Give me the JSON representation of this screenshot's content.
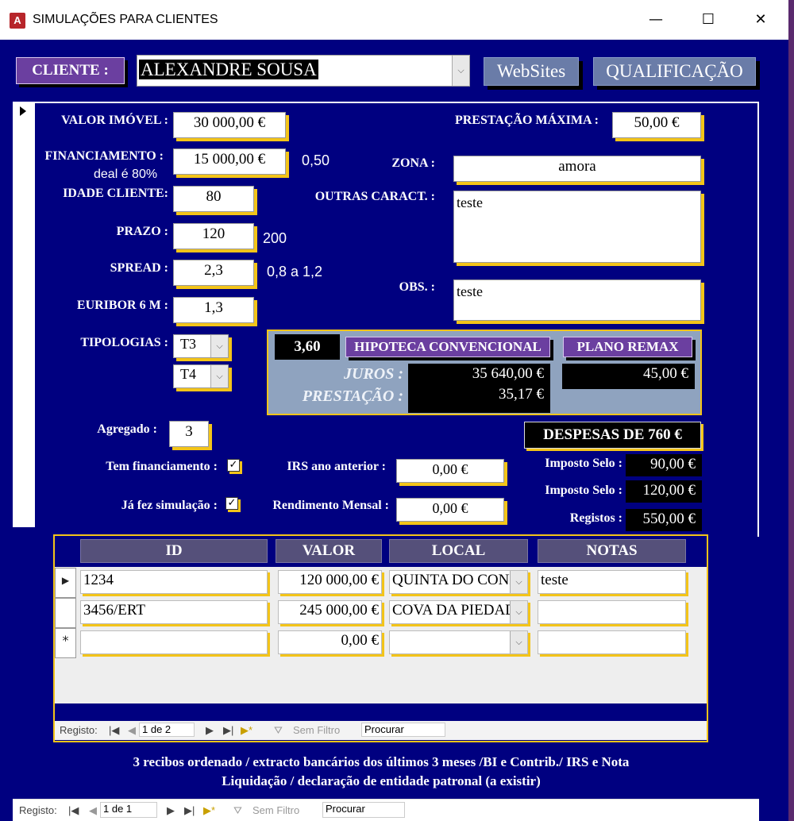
{
  "window": {
    "title": "SIMULAÇÕES PARA CLIENTES",
    "app_icon": "A",
    "minimize": "—",
    "maximize": "☐",
    "close": "✕"
  },
  "header": {
    "cliente_label": "CLIENTE :",
    "cliente_value": "ALEXANDRE SOUSA",
    "websites_button": "WebSites",
    "qualificacao_button": "QUALIFICAÇÃO"
  },
  "fields": {
    "valor_imovel_label": "VALOR IMÓVEL :",
    "valor_imovel": "30 000,00 €",
    "financiamento_label": "FINANCIAMENTO :",
    "financiamento": "15 000,00 €",
    "financiamento_ratio": "0,50",
    "deal_note": "deal é 80%",
    "idade_label": "IDADE CLIENTE:",
    "idade": "80",
    "prazo_label": "PRAZO :",
    "prazo": "120",
    "prazo_note": "200",
    "spread_label": "SPREAD :",
    "spread": "2,3",
    "spread_note": "0,8 a 1,2",
    "euribor_label": "EURIBOR 6 M :",
    "euribor": "1,3",
    "tipologias_label": "TIPOLOGIAS :",
    "tipologia_1": "T3",
    "tipologia_2": "T4",
    "prestacao_max_label": "PRESTAÇÃO MÁXIMA :",
    "prestacao_max": "50,00 €",
    "zona_label": "ZONA :",
    "zona": "amora",
    "outras_label": "OUTRAS CARACT. :",
    "outras": "teste",
    "obs_label": "OBS. :",
    "obs": "teste",
    "agregado_label": "Agregado :",
    "agregado": "3",
    "tem_financiamento_label": "Tem financiamento :",
    "ja_fez_simulacao_label": "Já fez simulação :",
    "irs_label": "IRS ano anterior :",
    "irs": "0,00 €",
    "rendimento_label": "Rendimento Mensal :",
    "rendimento": "0,00 €",
    "check_mark": "✓"
  },
  "simulation": {
    "taxa": "3,60",
    "hipoteca_button": "HIPOTECA CONVENCIONAL",
    "plano_button": "PLANO REMAX",
    "juros_label": "JUROS :",
    "prestacao_label": "PRESTAÇÃO :",
    "juros": "35 640,00 €",
    "prestacao": "35,17 €",
    "remax_value": "45,00 €"
  },
  "despesas": {
    "title": "DESPESAS DE 760 €",
    "imposto_selo_label_1": "Imposto Selo :",
    "imposto_selo_1": "90,00 €",
    "imposto_selo_label_2": "Imposto Selo :",
    "imposto_selo_2": "120,00 €",
    "registos_label": "Registos :",
    "registos": "550,00 €"
  },
  "subform": {
    "headers": [
      "ID",
      "VALOR",
      "LOCAL",
      "NOTAS"
    ],
    "rows": [
      {
        "selector": "▶",
        "id": "1234",
        "valor": "120 000,00 €",
        "local": "QUINTA DO CONDE",
        "notas": "teste"
      },
      {
        "selector": "",
        "id": "3456/ERT",
        "valor": "245 000,00 €",
        "local": "COVA DA PIEDADE",
        "notas": ""
      },
      {
        "selector": "*",
        "id": "",
        "valor": "0,00 €",
        "local": "",
        "notas": ""
      }
    ],
    "nav": {
      "registo_label": "Registo:",
      "position": "1 de 2",
      "filter": "Sem Filtro",
      "search": "Procurar"
    }
  },
  "footer_note": {
    "line1": "3 recibos ordenado / extracto bancários dos últimos 3 meses /BI e Contrib./ IRS e Nota",
    "line2": "Liquidação / declaração de entidade patronal (a existir)"
  },
  "main_nav": {
    "registo_label": "Registo:",
    "position": "1 de 1",
    "filter": "Sem Filtro",
    "search": "Procurar"
  }
}
